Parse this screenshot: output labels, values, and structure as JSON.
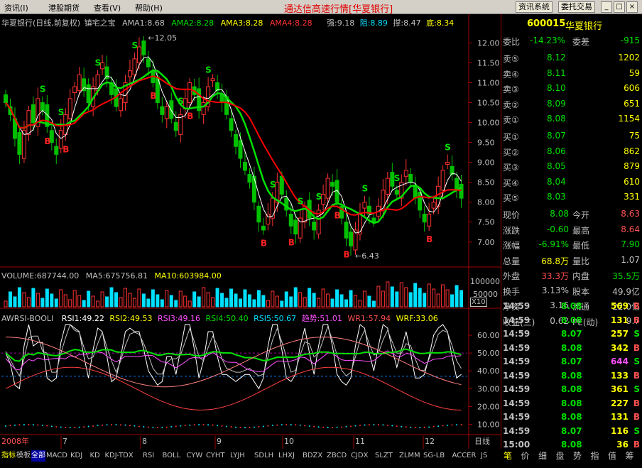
{
  "menu": {
    "items": [
      "资讯(I)",
      "港股期货",
      "查看(V)",
      "帮助(H)"
    ],
    "title": "通达信高速行情[华夏银行]",
    "buttons": [
      "资讯系统",
      "委托交易"
    ]
  },
  "window_controls": {
    "minimize": "_",
    "maximize": "□",
    "close": "×"
  },
  "main_info": {
    "label": "华夏银行(日线,前复权)",
    "indicator": "镇宅之宝",
    "ama1": "AMA1:8.68",
    "ama2": "AMA2:8.28",
    "ama3": "AMA3:8.28",
    "ama4": "AMA4:8.28",
    "strong": "强:9.18",
    "resist": "阻:8.89",
    "support": "撑:8.47",
    "bottom": "底:8.34"
  },
  "volume_info": {
    "volume": "VOLUME:687744.00",
    "ma5": "MA5:675756.81",
    "ma10": "MA10:603984.00",
    "x10": "X10"
  },
  "rsi_info": {
    "name": "AWRSI-BOOLI",
    "rsi1": "RSI1:49.22",
    "rsi2": "RSI2:49.53",
    "rsi3": "RSI3:49.16",
    "rsi4": "RSI4:50.40",
    "rsi5": "RSI5:50.67",
    "trend": "趋势:51.01",
    "wr1": "WR1:57.94",
    "wrf": "WRF:33.06"
  },
  "chart_data": {
    "type": "candlestick",
    "price_ticks": [
      "12.00",
      "11.50",
      "11.00",
      "10.50",
      "10.00",
      "9.50",
      "9.00",
      "8.50",
      "8.00",
      "7.50",
      "7.00"
    ],
    "high_marker": "12.05",
    "low_marker": "6.43",
    "volume_ticks": [
      "100000",
      "50000"
    ],
    "rsi_ticks": [
      "60.00",
      "50.00",
      "40.00",
      "30.00",
      "20.00",
      "10.00"
    ],
    "x_labels": [
      "2008年",
      "7",
      "8",
      "9",
      "10",
      "11",
      "12",
      "日线"
    ],
    "closes": [
      10.5,
      10.2,
      9.6,
      9.2,
      9.8,
      10.3,
      10.0,
      10.6,
      10.3,
      9.9,
      9.5,
      9.2,
      9.8,
      10.2,
      10.6,
      10.9,
      11.2,
      10.8,
      10.5,
      10.9,
      11.2,
      11.5,
      11.1,
      10.7,
      10.4,
      10.6,
      11.0,
      11.3,
      11.6,
      11.9,
      11.7,
      11.4,
      11.0,
      10.5,
      10.2,
      10.4,
      10.1,
      9.8,
      10.2,
      10.6,
      11.0,
      10.7,
      10.3,
      10.5,
      10.9,
      11.1,
      10.8,
      10.5,
      10.2,
      9.8,
      9.4,
      9.1,
      8.8,
      8.5,
      8.0,
      7.5,
      7.3,
      7.7,
      8.1,
      8.5,
      8.2,
      7.8,
      7.4,
      7.2,
      7.6,
      7.9,
      7.6,
      7.3,
      7.8,
      8.2,
      8.6,
      8.4,
      8.0,
      7.6,
      7.1,
      6.9,
      7.3,
      7.7,
      8.0,
      7.7,
      7.5,
      7.9,
      8.3,
      8.6,
      8.4,
      8.2,
      8.5,
      8.8,
      8.5,
      8.1,
      7.8,
      7.5,
      7.7,
      8.0,
      8.4,
      8.8,
      9.0,
      8.7,
      8.3,
      8.1
    ]
  },
  "quote": {
    "code": "600015",
    "name": "华夏银行",
    "wb_label": "委比",
    "wb": "-14.23%",
    "wc_label": "委差",
    "wc": "-915",
    "sells": [
      {
        "l": "卖⑤",
        "p": "8.12",
        "v": "1202"
      },
      {
        "l": "卖④",
        "p": "8.11",
        "v": "59"
      },
      {
        "l": "卖③",
        "p": "8.10",
        "v": "606"
      },
      {
        "l": "卖②",
        "p": "8.09",
        "v": "651"
      },
      {
        "l": "卖①",
        "p": "8.08",
        "v": "1154"
      }
    ],
    "buys": [
      {
        "l": "买①",
        "p": "8.07",
        "v": "75"
      },
      {
        "l": "买②",
        "p": "8.06",
        "v": "862"
      },
      {
        "l": "买③",
        "p": "8.05",
        "v": "879"
      },
      {
        "l": "买④",
        "p": "8.04",
        "v": "610"
      },
      {
        "l": "买⑤",
        "p": "8.03",
        "v": "331"
      }
    ],
    "stats": [
      {
        "l1": "现价",
        "v1": "8.08",
        "l2": "今开",
        "v2": "8.63"
      },
      {
        "l1": "涨跌",
        "v1": "-0.60",
        "l2": "最高",
        "v2": "8.64"
      },
      {
        "l1": "涨幅",
        "v1": "-6.91%",
        "l2": "最低",
        "v2": "7.90"
      },
      {
        "l1": "总量",
        "v1": "68.8万",
        "l2": "量比",
        "v2": "1.07"
      },
      {
        "l1": "外盘",
        "v1": "33.3万",
        "l2": "内盘",
        "v2": "35.5万"
      },
      {
        "l1": "换手",
        "v1": "3.13%",
        "l2": "股本",
        "v2": "49.9亿"
      },
      {
        "l1": "净资",
        "v1": "3.16",
        "l2": "流通",
        "v2": "22.0亿"
      },
      {
        "l1": "收益(三)",
        "v1": "0.62",
        "l2": "PE(动)",
        "v2": "9.7"
      }
    ],
    "ticks": [
      {
        "t": "14:59",
        "p": "8.08",
        "v": "569",
        "s": "B"
      },
      {
        "t": "14:59",
        "p": "8.08",
        "v": "131",
        "s": "B"
      },
      {
        "t": "14:59",
        "p": "8.07",
        "v": "257",
        "s": "S"
      },
      {
        "t": "14:59",
        "p": "8.08",
        "v": "342",
        "s": "B"
      },
      {
        "t": "14:59",
        "p": "8.07",
        "v": "644",
        "s": "S"
      },
      {
        "t": "14:59",
        "p": "8.08",
        "v": "133",
        "s": "B"
      },
      {
        "t": "14:59",
        "p": "8.08",
        "v": "361",
        "s": "S"
      },
      {
        "t": "14:59",
        "p": "8.08",
        "v": "227",
        "s": "B"
      },
      {
        "t": "14:59",
        "p": "8.08",
        "v": "131",
        "s": "B"
      },
      {
        "t": "14:59",
        "p": "8.07",
        "v": "116",
        "s": "S"
      },
      {
        "t": "15:00",
        "p": "8.08",
        "v": "36",
        "s": "B"
      }
    ]
  },
  "bottom_tabs": [
    "指标",
    "模板",
    "全部",
    "MACD",
    "KDJ",
    "KD",
    "KDJ-TDX",
    "RSI",
    "BOLL",
    "CYW",
    "CYHT",
    "LYJH",
    "SDLH",
    "LHXJ",
    "BDZX",
    "ZBCD",
    "CJDX",
    "SLZT",
    "ZLMM",
    "SG-LB",
    "ACCER",
    "JS"
  ],
  "right_tabs": [
    "笔",
    "价",
    "细",
    "盘",
    "势",
    "指",
    "值",
    "筹"
  ],
  "colors": {
    "up": "#ff3232",
    "down": "#00c000",
    "ama1": "#00e000",
    "ama2": "#ff0000",
    "ama3": "#ffff00",
    "text_red": "#ff5050",
    "text_green": "#00e000"
  }
}
